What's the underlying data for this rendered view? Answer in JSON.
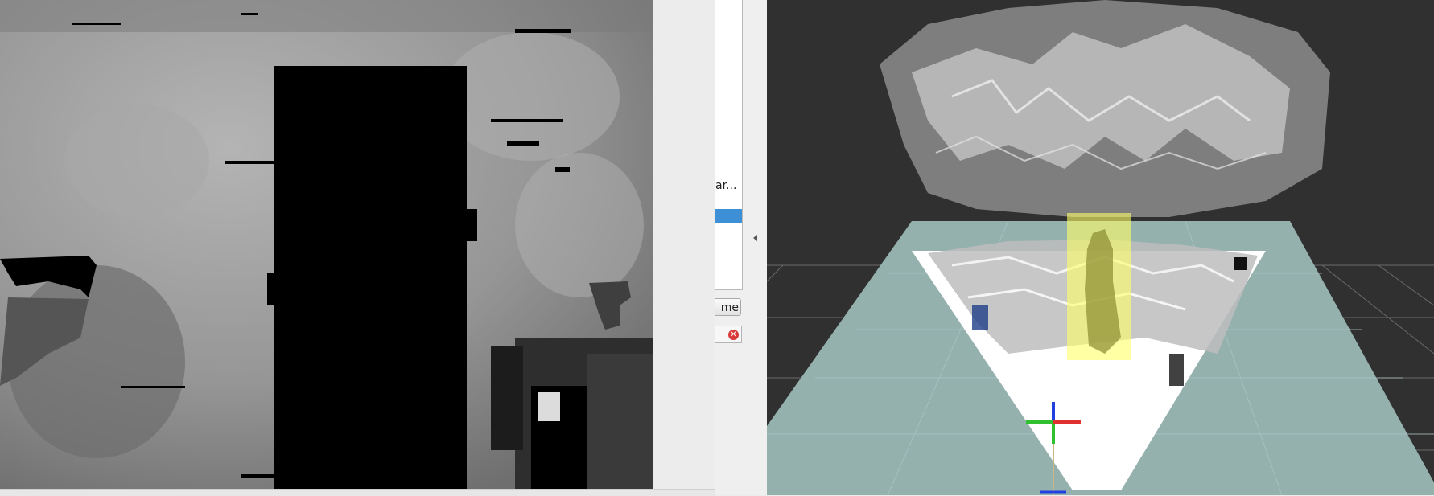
{
  "depth_view": {
    "description_icon": "depth-image",
    "occlusion_color": "#000000"
  },
  "side_panel": {
    "list_item_partial": "ar...",
    "time_button_partial": "me",
    "clear_icon": "close-circle-icon",
    "clear_glyph": "✕",
    "selected_color": "#3d8fd6"
  },
  "viewer_3d": {
    "background_color": "#303030",
    "ground_color": "#95b1ae",
    "detection_box_color": "#ffff66",
    "axis_colors": {
      "x": "#e03030",
      "y": "#30c030",
      "z": "#2040e0"
    }
  }
}
